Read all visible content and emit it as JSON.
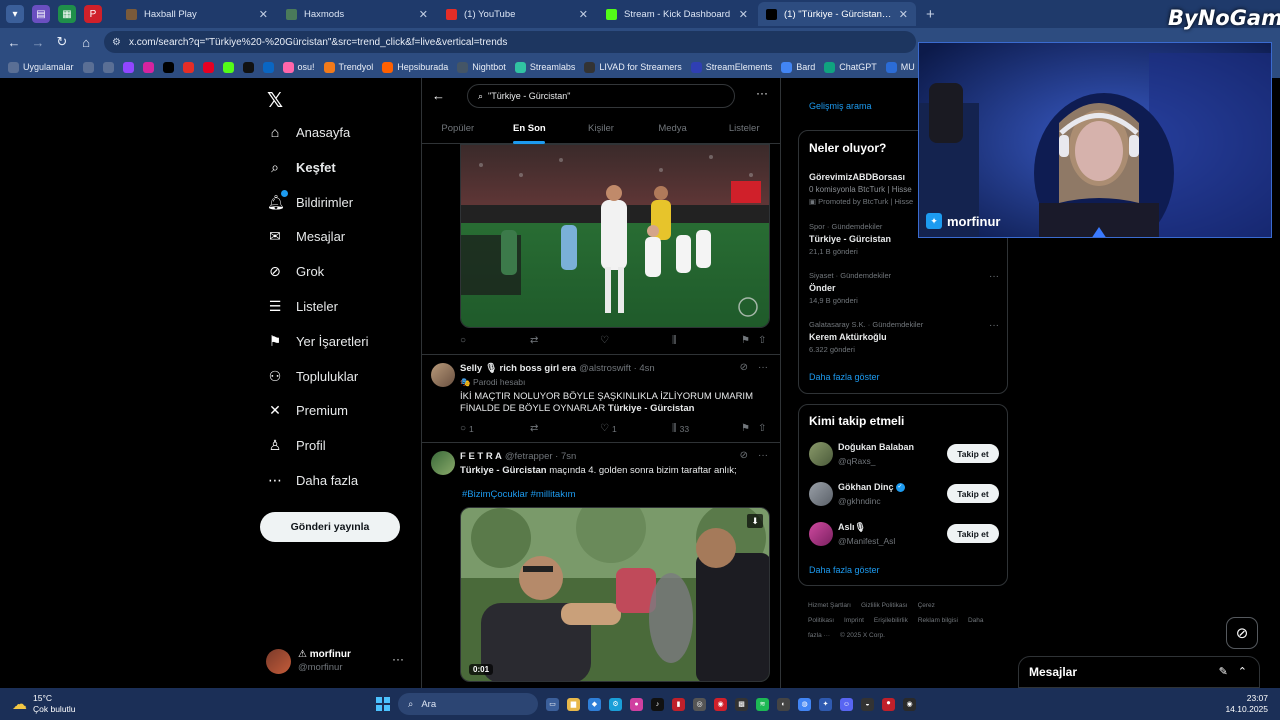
{
  "colors": {
    "accent": "#1d9bf0",
    "chrome": "#2d4c80",
    "tabbar": "#1f3a6b",
    "taskbar": "#1b2f57",
    "border": "#2f3336"
  },
  "browser": {
    "tabs": [
      {
        "title": "Haxball Play",
        "icon": "haxball-icon",
        "color": "#7a5a3a",
        "active": false
      },
      {
        "title": "Haxmods",
        "icon": "globe-icon",
        "color": "#4a7a5a",
        "active": false
      },
      {
        "title": "(1) YouTube",
        "icon": "youtube-icon",
        "color": "#e52d27",
        "active": false
      },
      {
        "title": "Stream - Kick Dashboard",
        "icon": "kick-icon",
        "color": "#53fc18",
        "active": false
      },
      {
        "title": "(1) \"Türkiye - Gürcistan\" - Aram",
        "icon": "x-icon",
        "color": "#000000",
        "active": true
      }
    ],
    "url": "x.com/search?q=\"Türkiye%20-%20Gürcistan\"&src=trend_click&f=live&vertical=trends",
    "bookmarks": [
      {
        "label": "Uygulamalar",
        "icon": "apps-grid-icon",
        "color": "#5a6f95"
      },
      {
        "label": "",
        "icon": "apps-icon",
        "color": "#5a6f95"
      },
      {
        "label": "",
        "icon": "star-icon",
        "color": "#5a6f95"
      },
      {
        "label": "",
        "icon": "twitch-icon",
        "color": "#9146ff"
      },
      {
        "label": "",
        "icon": "instagram-icon",
        "color": "#d6249f"
      },
      {
        "label": "",
        "icon": "x-icon",
        "color": "#000000"
      },
      {
        "label": "",
        "icon": "youtube-icon",
        "color": "#e52d27"
      },
      {
        "label": "",
        "icon": "pinterest-icon",
        "color": "#e60023"
      },
      {
        "label": "",
        "icon": "kick-icon",
        "color": "#53fc18"
      },
      {
        "label": "",
        "icon": "tiktok-icon",
        "color": "#111111"
      },
      {
        "label": "",
        "icon": "linkedin-icon",
        "color": "#0a66c2"
      },
      {
        "label": "osu!",
        "icon": "osu-icon",
        "color": "#ff66aa"
      },
      {
        "label": "Trendyol",
        "icon": "trendyol-icon",
        "color": "#f27a1a"
      },
      {
        "label": "Hepsiburada",
        "icon": "hepsiburada-icon",
        "color": "#ff6000"
      },
      {
        "label": "Nightbot",
        "icon": "nightbot-icon",
        "color": "#445566"
      },
      {
        "label": "Streamlabs",
        "icon": "streamlabs-icon",
        "color": "#31c3a2"
      },
      {
        "label": "LIVAD for Streamers",
        "icon": "livad-icon",
        "color": "#333333"
      },
      {
        "label": "StreamElements",
        "icon": "streamelements-icon",
        "color": "#2f3fb3"
      },
      {
        "label": "Bard",
        "icon": "bard-icon",
        "color": "#4285f4"
      },
      {
        "label": "ChatGPT",
        "icon": "chatgpt-icon",
        "color": "#10a37f"
      },
      {
        "label": "MU",
        "icon": "mu-icon",
        "color": "#2b6cd6"
      }
    ]
  },
  "x": {
    "nav": [
      {
        "label": "Anasayfa",
        "icon": "home-icon",
        "glyph": "⌂",
        "active": false
      },
      {
        "label": "Keşfet",
        "icon": "search-icon",
        "glyph": "⌕",
        "active": true
      },
      {
        "label": "Bildirimler",
        "icon": "bell-icon",
        "glyph": "🔔︎",
        "active": false
      },
      {
        "label": "Mesajlar",
        "icon": "mail-icon",
        "glyph": "✉",
        "active": false
      },
      {
        "label": "Grok",
        "icon": "grok-icon",
        "glyph": "⊘",
        "active": false
      },
      {
        "label": "Listeler",
        "icon": "list-icon",
        "glyph": "☰",
        "active": false
      },
      {
        "label": "Yer İşaretleri",
        "icon": "bookmark-icon",
        "glyph": "⚑",
        "active": false
      },
      {
        "label": "Topluluklar",
        "icon": "communities-icon",
        "glyph": "⚇",
        "active": false
      },
      {
        "label": "Premium",
        "icon": "x-premium-icon",
        "glyph": "✕",
        "active": false
      },
      {
        "label": "Profil",
        "icon": "profile-icon",
        "glyph": "♙",
        "active": false
      },
      {
        "label": "Daha fazla",
        "icon": "more-circle-icon",
        "glyph": "⋯",
        "active": false
      }
    ],
    "post_button": "Gönderi yayınla",
    "me": {
      "name": "⚠ morfinur",
      "handle": "@morfinur"
    },
    "search": {
      "query": "\"Türkiye - Gürcistan\""
    },
    "tabs": [
      "Popüler",
      "En Son",
      "Kişiler",
      "Medya",
      "Listeler"
    ],
    "active_tab": 1,
    "first_actions": {
      "replies": "",
      "reposts": "",
      "likes": "",
      "views": ""
    },
    "tweets": [
      {
        "name": "Selly 🎙 rich boss girl era",
        "handle": "@alstroswift · 4sn",
        "sub": "🎭 Parodi hesabı",
        "text_pre": "İKİ MAÇTIR NOLUYOR BÖYLE ŞAŞKINLIKLA İZLİYORUM UMARIM FİNALDE DE BÖYLE OYNARLAR ",
        "text_bold": "Türkiye - Gürcistan",
        "replies": "1",
        "reposts": "",
        "likes": "1",
        "views": "33"
      },
      {
        "name": "F E T R A",
        "handle": "@fetrapper · 7sn",
        "text_bold": "Türkiye - Gürcistan",
        "text_post": " maçında 4. golden sonra bizim taraftar anlık;",
        "hashtags": "#BizimÇocuklar #millitakım",
        "video_time": "0:01"
      }
    ],
    "right": {
      "advanced_search": "Gelişmiş arama",
      "trends_title": "Neler oluyor?",
      "promoted": {
        "name": "GörevimizABDBorsası",
        "desc": "0 komisyonla BtcTurk | Hisse",
        "by": "Promoted by BtcTurk | Hisse"
      },
      "trends": [
        {
          "meta": "Spor · Gündemdekiler",
          "name": "Türkiye - Gürcistan",
          "count": "21,1 B gönderi"
        },
        {
          "meta": "Siyaset · Gündemdekiler",
          "name": "Önder",
          "count": "14,9 B gönderi"
        },
        {
          "meta": "Galatasaray S.K. · Gündemdekiler",
          "name": "Kerem Aktürkoğlu",
          "count": "6.322 gönderi"
        }
      ],
      "show_more": "Daha fazla göster",
      "who_title": "Kimi takip etmeli",
      "who": [
        {
          "name": "Doğukan Balaban",
          "handle": "@qRaxs_",
          "verified": false,
          "btn": "Takip et"
        },
        {
          "name": "Gökhan Dinç",
          "handle": "@gkhndinc",
          "verified": true,
          "btn": "Takip et"
        },
        {
          "name": "Aslı🎙",
          "handle": "@Manifest_Asl",
          "verified": false,
          "btn": "Takip et"
        }
      ],
      "who_more": "Daha fazla göster",
      "footer": [
        "Hizmet Şartları",
        "Gizlilik Politikası",
        "Çerez Politikası",
        "Imprint",
        "Erişilebilirlik",
        "Reklam bilgisi",
        "Daha fazla ···",
        "© 2025 X Corp."
      ]
    },
    "messages_dock": "Mesajlar"
  },
  "stream": {
    "cam_name": "morfinur",
    "brand": "ByNoGame"
  },
  "taskbar": {
    "temp": "15°C",
    "weather": "Çok bulutlu",
    "search": "Ara",
    "time": "23:07",
    "date": "14.10.2025"
  }
}
